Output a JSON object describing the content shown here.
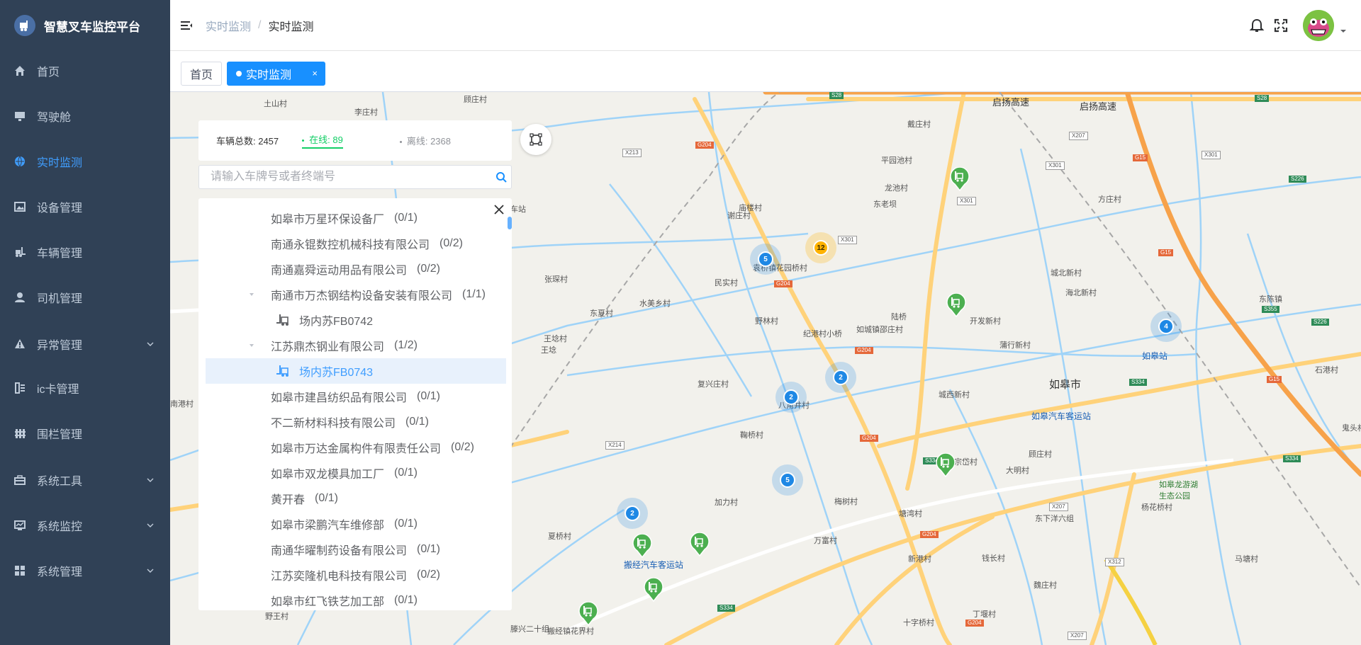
{
  "app": {
    "title": "智慧叉车监控平台"
  },
  "sidebar": {
    "items": [
      {
        "label": "首页",
        "icon": "home-icon",
        "active": false,
        "arrow": false
      },
      {
        "label": "驾驶舱",
        "icon": "monitor-icon",
        "active": false,
        "arrow": false
      },
      {
        "label": "实时监测",
        "icon": "globe-icon",
        "active": true,
        "arrow": false
      },
      {
        "label": "设备管理",
        "icon": "image-icon",
        "active": false,
        "arrow": false
      },
      {
        "label": "车辆管理",
        "icon": "forklift-icon",
        "active": false,
        "arrow": false
      },
      {
        "label": "司机管理",
        "icon": "user-icon",
        "active": false,
        "arrow": false
      },
      {
        "label": "异常管理",
        "icon": "warning-icon",
        "active": false,
        "arrow": true
      },
      {
        "label": "ic卡管理",
        "icon": "card-icon",
        "active": false,
        "arrow": false
      },
      {
        "label": "围栏管理",
        "icon": "fence-icon",
        "active": false,
        "arrow": false
      },
      {
        "label": "系统工具",
        "icon": "toolbox-icon",
        "active": false,
        "arrow": true
      },
      {
        "label": "系统监控",
        "icon": "chart-icon",
        "active": false,
        "arrow": true
      },
      {
        "label": "系统管理",
        "icon": "grid-icon",
        "active": false,
        "arrow": true
      }
    ]
  },
  "header": {
    "breadcrumb": [
      "实时监测",
      "实时监测"
    ]
  },
  "tags": {
    "home": "首页",
    "active": "实时监测",
    "close": "×"
  },
  "stats": {
    "total": "车辆总数: 2457",
    "online": "在线: 89",
    "offline": "离线: 2368"
  },
  "search": {
    "placeholder": "请输入车牌号或者终端号"
  },
  "tree": {
    "rows": [
      {
        "label": "如皋市万星环保设备厂",
        "count": "(0/1)",
        "level": 1,
        "type": "company",
        "expanded": false,
        "selected": false
      },
      {
        "label": "南通永锟数控机械科技有限公司",
        "count": "(0/2)",
        "level": 1,
        "type": "company",
        "expanded": false,
        "selected": false
      },
      {
        "label": "南通嘉舜运动用品有限公司",
        "count": "(0/2)",
        "level": 1,
        "type": "company",
        "expanded": false,
        "selected": false
      },
      {
        "label": "南通市万杰钢结构设备安装有限公司",
        "count": "(1/1)",
        "level": 1,
        "type": "company",
        "expanded": true,
        "selected": false
      },
      {
        "label": "场内苏FB0742",
        "count": "",
        "level": 2,
        "type": "vehicle",
        "expanded": false,
        "selected": false
      },
      {
        "label": "江苏鼎杰钢业有限公司",
        "count": "(1/2)",
        "level": 1,
        "type": "company",
        "expanded": true,
        "selected": false
      },
      {
        "label": "场内苏FB0743",
        "count": "",
        "level": 2,
        "type": "vehicle",
        "expanded": false,
        "selected": true
      },
      {
        "label": "如皋市建昌纺织品有限公司",
        "count": "(0/1)",
        "level": 1,
        "type": "company",
        "expanded": false,
        "selected": false
      },
      {
        "label": "不二新材料科技有限公司",
        "count": "(0/1)",
        "level": 1,
        "type": "company",
        "expanded": false,
        "selected": false
      },
      {
        "label": "如皋市万达金属构件有限责任公司",
        "count": "(0/2)",
        "level": 1,
        "type": "company",
        "expanded": false,
        "selected": false
      },
      {
        "label": "如皋市双龙模具加工厂",
        "count": "(0/1)",
        "level": 1,
        "type": "company",
        "expanded": false,
        "selected": false
      },
      {
        "label": "黄开春",
        "count": "(0/1)",
        "level": 1,
        "type": "company",
        "expanded": false,
        "selected": false
      },
      {
        "label": "如皋市梁鹏汽车维修部",
        "count": "(0/1)",
        "level": 1,
        "type": "company",
        "expanded": false,
        "selected": false
      },
      {
        "label": "南通华曜制药设备有限公司",
        "count": "(0/1)",
        "level": 1,
        "type": "company",
        "expanded": false,
        "selected": false
      },
      {
        "label": "江苏奕隆机电科技有限公司",
        "count": "(0/2)",
        "level": 1,
        "type": "company",
        "expanded": false,
        "selected": false
      },
      {
        "label": "如皋市红飞铁艺加工部",
        "count": "(0/1)",
        "level": 1,
        "type": "company",
        "expanded": false,
        "selected": false
      }
    ]
  },
  "map": {
    "city": "如皋市",
    "labels": [
      "土山村",
      "李庄村",
      "顾庄村",
      "启扬高速",
      "戴庄村",
      "启扬高速",
      "平园池村",
      "龙池村",
      "东老坝",
      "方庄村",
      "张琛村",
      "东夏村",
      "水美乡村",
      "民实村",
      "袁桥镇花园桥村",
      "城北新村",
      "海北新村",
      "王埝村",
      "王埝",
      "庙楼村",
      "野林村",
      "纪港村小桥",
      "如城镇邵庄村",
      "开发新村",
      "东陈镇",
      "蒲行新村",
      "陆桥",
      "复兴庄村",
      "八角井村",
      "城西新村",
      "如皋汽车客运站",
      "石港村",
      "如皋站",
      "鞠桥村",
      "梅树村",
      "宗岱村",
      "大明村",
      "顾庄村",
      "加力村",
      "塘湾村",
      "万富村",
      "新港村",
      "钱长村",
      "东下洋六组",
      "杨花桥村",
      "马塘村",
      "夏桥村",
      "如皋龙游湖生态公园",
      "十字桥村",
      "丁堰村",
      "搬经镇花界村",
      "搬经汽车客运站",
      "野王村",
      "滕兴二十组",
      "南港村",
      "鬼头村",
      "车站",
      "谢庄村",
      "魏庄村"
    ],
    "cluster_counts": [
      "5",
      "12",
      "4",
      "2",
      "2",
      "5",
      "2"
    ],
    "road_badges": [
      "S28",
      "S28",
      "X207",
      "X301",
      "X213",
      "G204",
      "X301",
      "G15",
      "X301",
      "S226",
      "G15",
      "G204",
      "X301",
      "S355",
      "S226",
      "G204",
      "S334",
      "G15",
      "X214",
      "G204",
      "S334",
      "S334",
      "X207",
      "G204",
      "X312",
      "S334",
      "G204",
      "X207"
    ]
  },
  "colors": {
    "sidebar_bg": "#304156",
    "accent": "#1890ff",
    "online": "#13ce66",
    "cluster": "#1e88e5",
    "cluster_hot": "#ffb300",
    "marker": "#4caf50"
  }
}
